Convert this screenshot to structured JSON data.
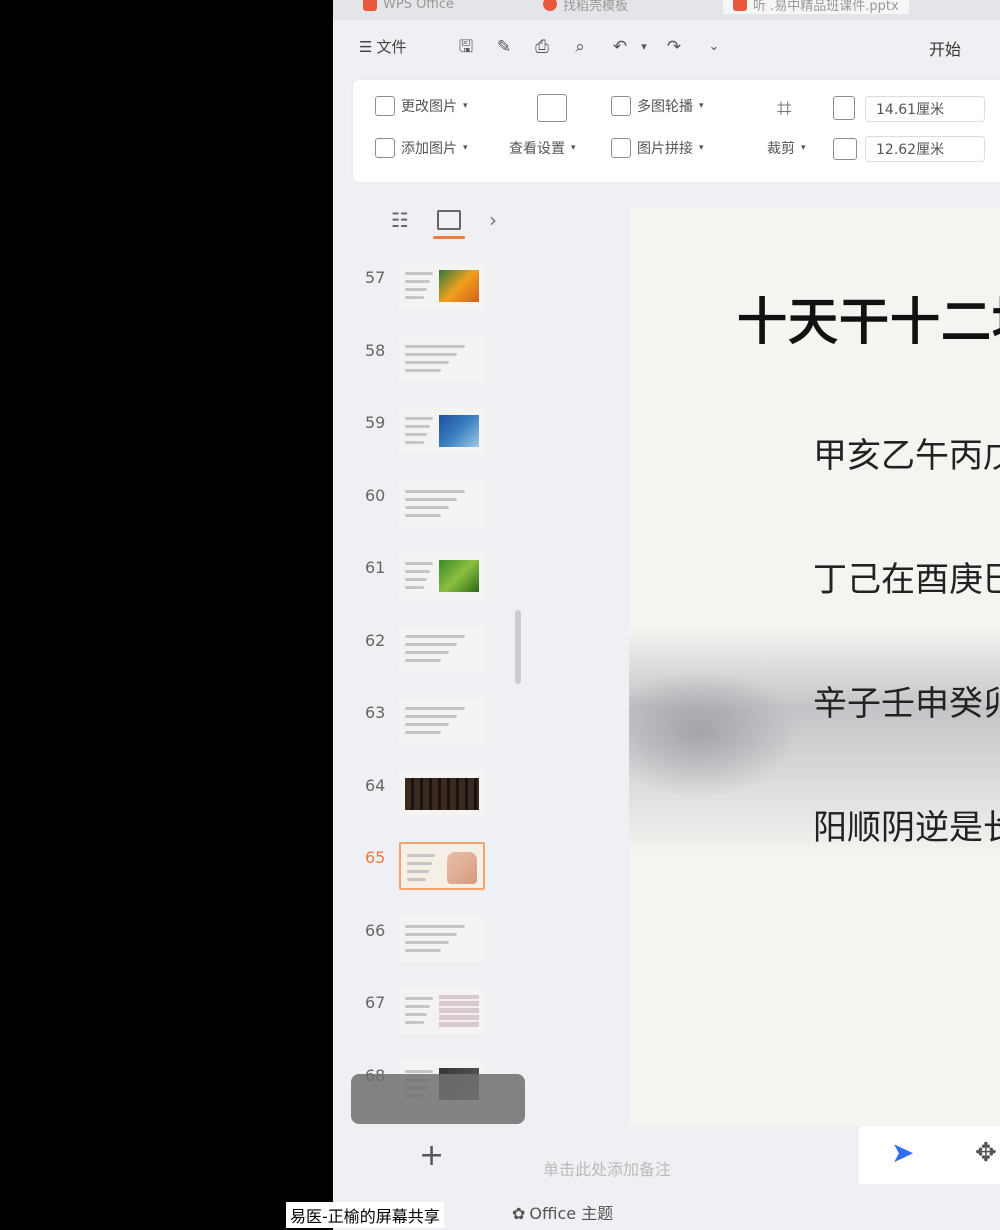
{
  "tabs": [
    {
      "label": "WPS Office"
    },
    {
      "label": "找稻壳模板"
    },
    {
      "label": "听 .易中精品班课件.pptx"
    }
  ],
  "menu": {
    "file_label": "文件",
    "start_label": "开始"
  },
  "ribbon": {
    "change_picture": "更改图片",
    "add_picture": "添加图片",
    "view_settings": "查看设置",
    "multi_carousel": "多图轮播",
    "picture_stitch": "图片拼接",
    "crop": "裁剪",
    "width_value": "14.61厘米",
    "height_value": "12.62厘米"
  },
  "colors": {
    "accent": "#f07b3f",
    "selected_border": "#f2a26a",
    "pick_blue": "#2f6cf3"
  },
  "slides": {
    "items": [
      {
        "number": "57"
      },
      {
        "number": "58"
      },
      {
        "number": "59"
      },
      {
        "number": "60"
      },
      {
        "number": "61"
      },
      {
        "number": "62"
      },
      {
        "number": "63"
      },
      {
        "number": "64"
      },
      {
        "number": "65"
      },
      {
        "number": "66"
      },
      {
        "number": "67"
      },
      {
        "number": "68"
      }
    ],
    "selected": "65"
  },
  "slide": {
    "title": "十天干十二地",
    "lines": [
      "甲亥乙午丙戊",
      "丁己在酉庚巳",
      "辛子壬申癸卯",
      "阳顺阴逆是长"
    ]
  },
  "notes_placeholder": "单击此处添加备注",
  "status": {
    "screen_share": "易医-正榆的屏幕共享",
    "office_theme": "Office 主题"
  }
}
